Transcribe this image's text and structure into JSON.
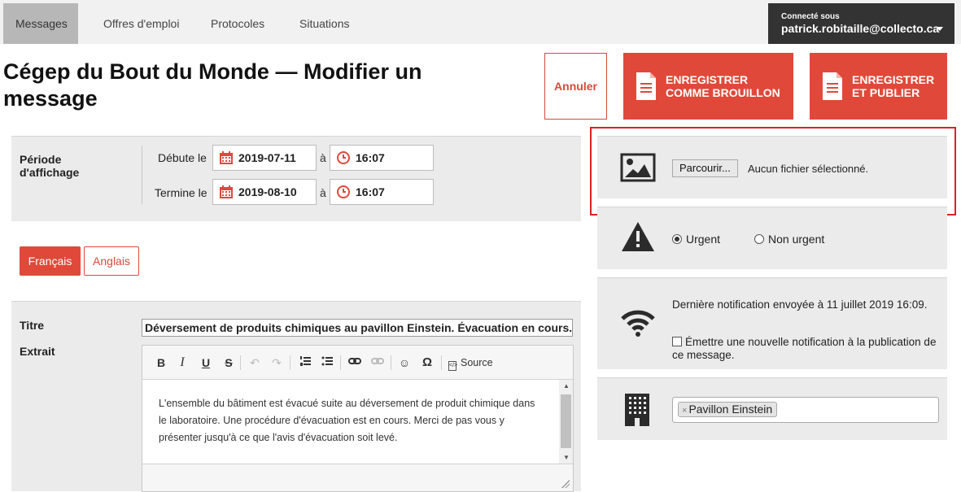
{
  "nav": {
    "tabs": [
      "Messages",
      "Offres d'emploi",
      "Protocoles",
      "Situations"
    ],
    "user": {
      "label": "Connecté sous",
      "email": "patrick.robitaille@collecto.ca"
    }
  },
  "header": {
    "title": "Cégep du Bout du Monde — Modifier un message",
    "cancel": "Annuler",
    "save_draft": [
      "ENREGISTRER",
      "COMME BROUILLON"
    ],
    "save_publish": [
      "ENREGISTRER",
      "ET PUBLIER"
    ]
  },
  "period": {
    "label": [
      "Période",
      "d'affichage"
    ],
    "start_label": "Débute le",
    "end_label": "Termine le",
    "sep": "à",
    "start_date": "2019-07-11",
    "start_time": "16:07",
    "end_date": "2019-08-10",
    "end_time": "16:07"
  },
  "languages": [
    "Français",
    "Anglais"
  ],
  "content": {
    "title_label": "Titre",
    "title_value": "Déversement de produits chimiques au pavillon Einstein. Évacuation en cours.",
    "excerpt_label": "Extrait",
    "source_label": "Source",
    "body": "L'ensemble du bâtiment est évacué suite au déversement de produit chimique dans le laboratoire. Une procédure d'évacuation est en cours. Merci de pas vous y présenter jusqu'à ce que l'avis d'évacuation soit levé."
  },
  "image": {
    "browse": "Parcourir...",
    "no_file": "Aucun fichier sélectionné."
  },
  "priority": {
    "urgent": "Urgent",
    "not_urgent": "Non urgent",
    "selected": "Urgent"
  },
  "notification": {
    "last": "Dernière notification envoyée à 11 juillet 2019 16:09.",
    "send_new": "Émettre une nouvelle notification à la publication de ce message."
  },
  "building": {
    "tags": [
      "Pavillon Einstein"
    ]
  },
  "colors": {
    "accent": "#e0493a",
    "dark": "#333333",
    "highlight": "#e02020"
  }
}
